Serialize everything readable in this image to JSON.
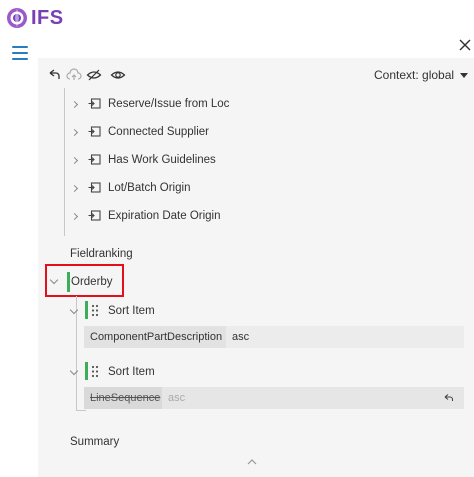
{
  "app": {
    "logo_text": "IFS"
  },
  "toolbar": {
    "icons": [
      "undo-icon",
      "cloud-upload-icon",
      "hide-icon",
      "eye-icon"
    ],
    "context_label": "Context: global"
  },
  "tree": {
    "reference_items": [
      {
        "label": "Reserve/Issue from Loc"
      },
      {
        "label": "Connected Supplier"
      },
      {
        "label": "Has Work Guidelines"
      },
      {
        "label": "Lot/Batch Origin"
      },
      {
        "label": "Expiration Date Origin"
      }
    ],
    "fieldranking_label": "Fieldranking",
    "orderby_label": "Orderby",
    "sort_items": [
      {
        "label": "Sort Item",
        "field": "ComponentPartDescription",
        "direction": "asc",
        "removed": false
      },
      {
        "label": "Sort Item",
        "field": "LineSequence",
        "direction": "asc",
        "removed": true
      }
    ],
    "summary_label": "Summary"
  },
  "colors": {
    "accent_green": "#3cae5a",
    "highlight_red": "#e3101c",
    "brand_purple": "#7a3fb5"
  }
}
